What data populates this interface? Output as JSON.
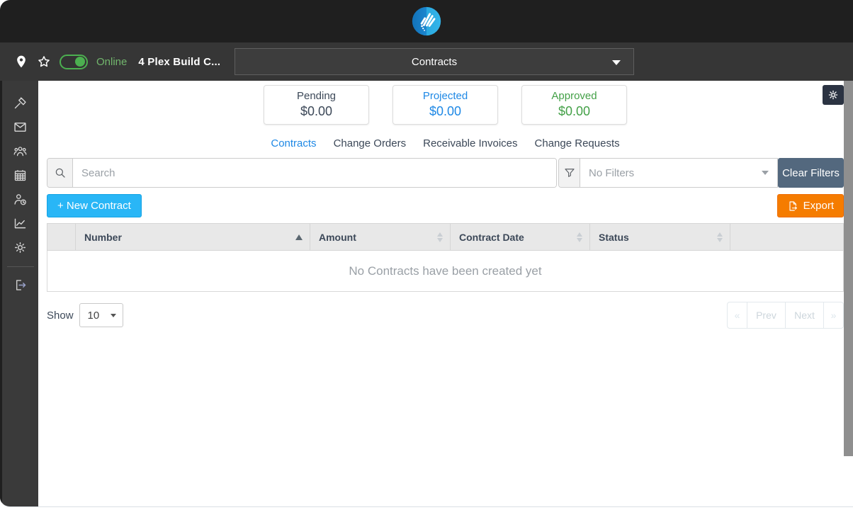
{
  "topbar": {
    "logo": "knowify-logo"
  },
  "project_bar": {
    "online_toggle": {
      "state": "on",
      "label": "Online",
      "color": "#4caf50"
    },
    "project_name": "4 Plex Build C...",
    "module_dropdown": {
      "value": "Contracts"
    }
  },
  "sidebar": {
    "icons": [
      "hammer-icon",
      "envelope-icon",
      "team-icon",
      "calendar-icon",
      "user-clock-icon",
      "chart-icon",
      "gear-icon",
      "logout-icon"
    ]
  },
  "summary_cards": [
    {
      "label": "Pending",
      "value": "$0.00",
      "color": "#3c4858"
    },
    {
      "label": "Projected",
      "value": "$0.00",
      "color": "#1e88e5"
    },
    {
      "label": "Approved",
      "value": "$0.00",
      "color": "#43a047"
    }
  ],
  "tabs": [
    {
      "label": "Contracts",
      "active": true
    },
    {
      "label": "Change Orders",
      "active": false
    },
    {
      "label": "Receivable Invoices",
      "active": false
    },
    {
      "label": "Change Requests",
      "active": false
    }
  ],
  "search": {
    "placeholder": "Search"
  },
  "filter": {
    "value": "No Filters",
    "clear_button": "Clear Filters"
  },
  "actions": {
    "new_contract": "+ New Contract",
    "export": "Export"
  },
  "table": {
    "columns": [
      {
        "label": "Number",
        "sort": "asc"
      },
      {
        "label": "Amount",
        "sort": "none"
      },
      {
        "label": "Contract Date",
        "sort": "none"
      },
      {
        "label": "Status",
        "sort": "none"
      }
    ],
    "empty_message": "No Contracts have been created yet"
  },
  "pager": {
    "show_label": "Show",
    "page_size": "10",
    "first": "«",
    "prev": "Prev",
    "next": "Next",
    "last": "»"
  },
  "colors": {
    "accent_blue": "#1e88e5",
    "green": "#43a047",
    "toggle_green": "#4caf50",
    "cyan_button": "#29b6f6",
    "orange_button": "#f57c00",
    "slate_button": "#53687e",
    "topbar": "#1f1f1f",
    "sidebar": "#3a3a3a"
  }
}
